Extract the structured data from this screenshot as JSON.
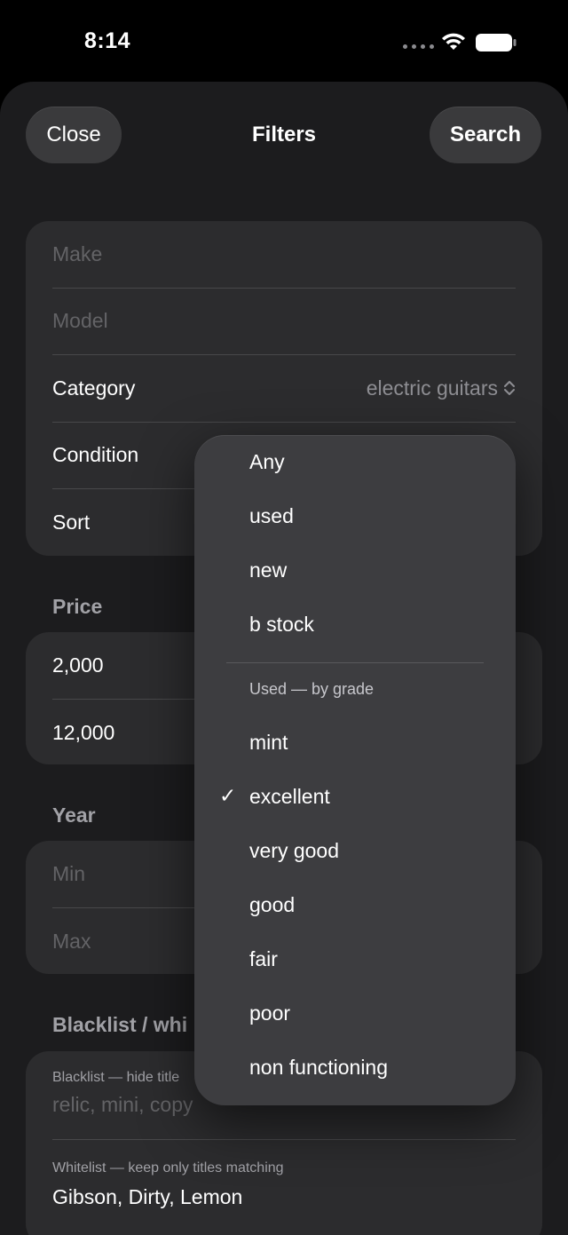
{
  "status": {
    "time": "8:14"
  },
  "nav": {
    "close_label": "Close",
    "title": "Filters",
    "search_label": "Search"
  },
  "filters": {
    "make_placeholder": "Make",
    "model_placeholder": "Model",
    "category_label": "Category",
    "category_value": "electric guitars",
    "condition_label": "Condition",
    "sort_label": "Sort"
  },
  "price": {
    "header": "Price",
    "min_value": "2,000",
    "max_value": "12,000"
  },
  "year": {
    "header": "Year",
    "min_placeholder": "Min",
    "max_placeholder": "Max"
  },
  "lists": {
    "header": "Blacklist / whi",
    "blacklist_label": "Blacklist — hide title",
    "blacklist_placeholder": "relic, mini, copy",
    "whitelist_label": "Whitelist — keep only titles matching",
    "whitelist_value": "Gibson, Dirty, Lemon"
  },
  "condition_menu": {
    "items": [
      "Any",
      "used",
      "new",
      "b stock"
    ],
    "section_title": "Used — by grade",
    "grades": [
      "mint",
      "excellent",
      "very good",
      "good",
      "fair",
      "poor",
      "non functioning"
    ],
    "selected": "excellent",
    "check": "✓"
  },
  "icons": {
    "wifi": "wifi-icon",
    "battery": "battery-icon",
    "chevron": "chevron-up-down-icon",
    "checkmark": "checkmark-icon"
  }
}
